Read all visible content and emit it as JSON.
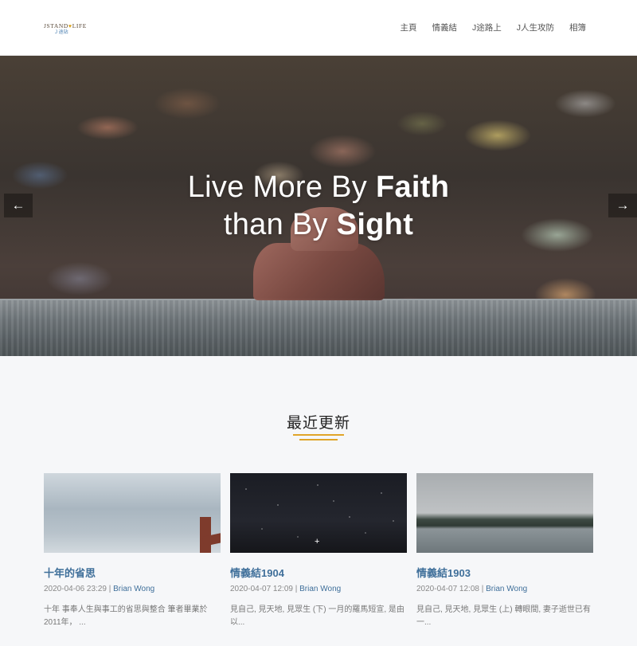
{
  "logo": {
    "line1": "JSTAND",
    "heart": "♥",
    "line1b": "LIFE",
    "line2": "J 途站"
  },
  "nav": {
    "items": [
      "主頁",
      "情義結",
      "J途路上",
      "J人生攻防",
      "相簿"
    ]
  },
  "hero": {
    "line1_light": "Live More By ",
    "line1_bold": "Faith",
    "line2_light": "than By ",
    "line2_bold": "Sight",
    "prev_icon": "←",
    "next_icon": "→"
  },
  "section": {
    "title": "最近更新",
    "accent_color": "#e0a52a"
  },
  "cards": [
    {
      "title": "十年的省思",
      "date": "2020-04-06 23:29",
      "author": "Brian Wong",
      "excerpt": "十年 事奉人生與事工的省思與整合 筆者畢業於2011年，  ..."
    },
    {
      "title": "情義結1904",
      "date": "2020-04-07 12:09",
      "author": "Brian Wong",
      "excerpt": "見自己, 見天地, 見眾生 (下) 一月的羅馬短宣, 是由以..."
    },
    {
      "title": "情義結1903",
      "date": "2020-04-07 12:08",
      "author": "Brian Wong",
      "excerpt": "見自己, 見天地, 見眾生 (上) 轉眼間, 妻子逝世已有一..."
    }
  ],
  "meta_separator": " | "
}
